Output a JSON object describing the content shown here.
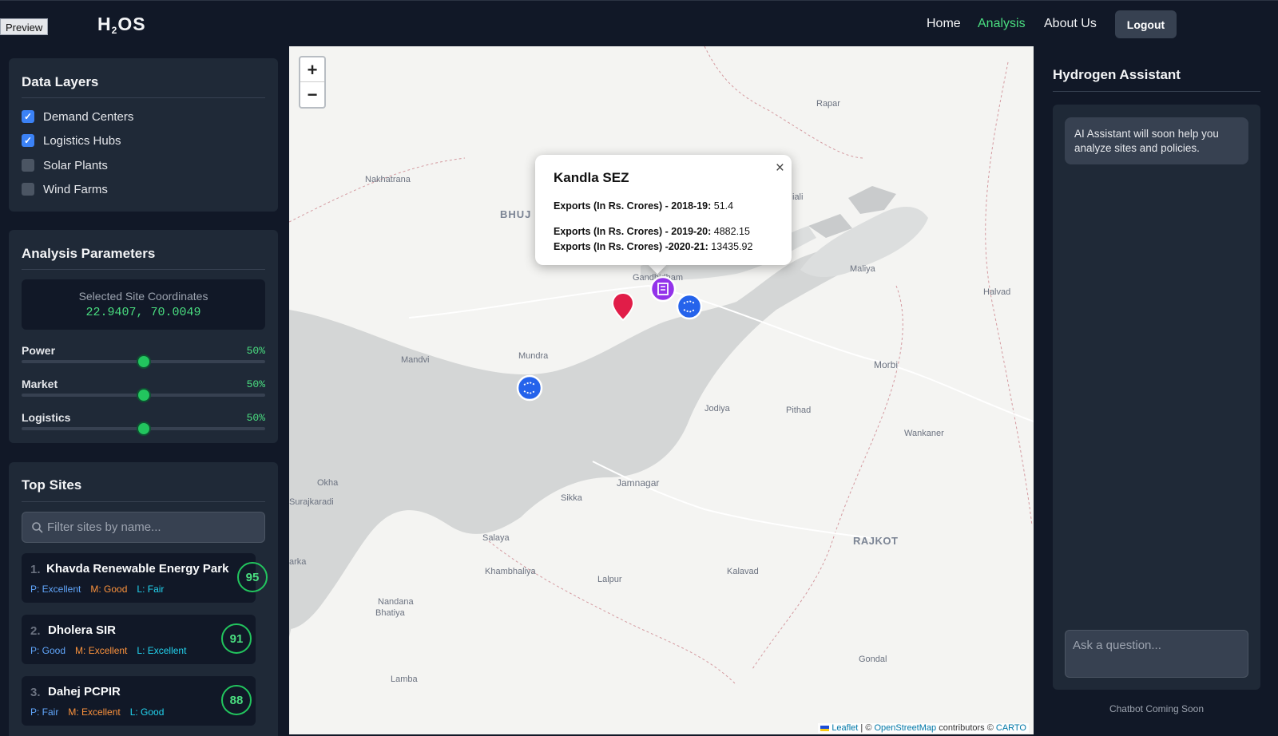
{
  "header": {
    "preview_tag": "Preview",
    "logo_main": "H",
    "logo_sub": "2",
    "logo_tail": "OS",
    "nav": [
      "Home",
      "Analysis",
      "About Us"
    ],
    "active_nav": "Analysis",
    "logout_label": "Logout"
  },
  "data_layers": {
    "title": "Data Layers",
    "items": [
      {
        "label": "Demand Centers",
        "checked": true
      },
      {
        "label": "Logistics Hubs",
        "checked": true
      },
      {
        "label": "Solar Plants",
        "checked": false
      },
      {
        "label": "Wind Farms",
        "checked": false
      }
    ]
  },
  "analysis": {
    "title": "Analysis Parameters",
    "coords_label": "Selected Site Coordinates",
    "coords_value": "22.9407, 70.0049",
    "params": [
      {
        "label": "Power",
        "value": "50%",
        "level": 0.5
      },
      {
        "label": "Market",
        "value": "50%",
        "level": 0.5
      },
      {
        "label": "Logistics",
        "value": "50%",
        "level": 0.5
      }
    ]
  },
  "top_sites": {
    "title": "Top Sites",
    "search_placeholder": "Filter sites by name...",
    "sites": [
      {
        "rank": "1.",
        "name": "Khavda Renewable Energy Park",
        "score": "95",
        "p": "P: Excellent",
        "m": "M: Good",
        "l": "L: Fair"
      },
      {
        "rank": "2.",
        "name": "Dholera SIR",
        "score": "91",
        "p": "P: Good",
        "m": "M: Excellent",
        "l": "L: Excellent"
      },
      {
        "rank": "3.",
        "name": "Dahej PCPIR",
        "score": "88",
        "p": "P: Fair",
        "m": "M: Excellent",
        "l": "L: Good"
      }
    ]
  },
  "map": {
    "zoom_in": "+",
    "zoom_out": "−",
    "labels": [
      {
        "text": "Rapar",
        "kind": "town"
      },
      {
        "text": "Nakhatrana",
        "kind": "town"
      },
      {
        "text": "BHUJ",
        "kind": "city"
      },
      {
        "text": "Maliya",
        "kind": "town"
      },
      {
        "text": "Halvad",
        "kind": "town"
      },
      {
        "text": "Gandhidham",
        "kind": "town"
      },
      {
        "text": "Mandvi",
        "kind": "town"
      },
      {
        "text": "Mundra",
        "kind": "town"
      },
      {
        "text": "Morbi",
        "kind": "town"
      },
      {
        "text": "Jodiya",
        "kind": "town"
      },
      {
        "text": "Pithad",
        "kind": "town"
      },
      {
        "text": "Wankaner",
        "kind": "town"
      },
      {
        "text": "Okha",
        "kind": "town"
      },
      {
        "text": "Surajkaradi",
        "kind": "town"
      },
      {
        "text": "Jamnagar",
        "kind": "town"
      },
      {
        "text": "Sikka",
        "kind": "town"
      },
      {
        "text": "Salaya",
        "kind": "town"
      },
      {
        "text": "RAJKOT",
        "kind": "city"
      },
      {
        "text": "Khambhaliya",
        "kind": "town"
      },
      {
        "text": "Lalpur",
        "kind": "town"
      },
      {
        "text": "Kalavad",
        "kind": "town"
      },
      {
        "text": "Nandana",
        "kind": "town"
      },
      {
        "text": "Bhatiya",
        "kind": "town"
      },
      {
        "text": "Lamba",
        "kind": "town"
      },
      {
        "text": "Gondal",
        "kind": "town"
      },
      {
        "text": "iali",
        "kind": "town"
      },
      {
        "text": "arka",
        "kind": "town"
      }
    ],
    "popup": {
      "title": "Kandla SEZ",
      "close": "×",
      "rows": [
        {
          "key": "Exports (In Rs. Crores) - 2018-19:",
          "value": "51.4"
        },
        {
          "key": "Exports (In Rs. Crores) - 2019-20:",
          "value": "4882.15"
        },
        {
          "key": "Exports (In Rs. Crores) -2020-21:",
          "value": "13435.92"
        }
      ]
    },
    "attribution": {
      "leaflet": "Leaflet",
      "sep1": " | © ",
      "osm": "OpenStreetMap",
      "mid": " contributors © ",
      "carto": "CARTO"
    }
  },
  "assistant": {
    "title": "Hydrogen Assistant",
    "message": "AI Assistant will soon help you analyze sites and policies.",
    "input_placeholder": "Ask a question...",
    "footer": "Chatbot Coming Soon"
  },
  "colors": {
    "accent_green": "#4ade80",
    "bg": "#111827",
    "panel": "#1f2937",
    "marker_red": "#e11d48",
    "marker_purple": "#9333ea",
    "marker_blue": "#2563eb"
  }
}
